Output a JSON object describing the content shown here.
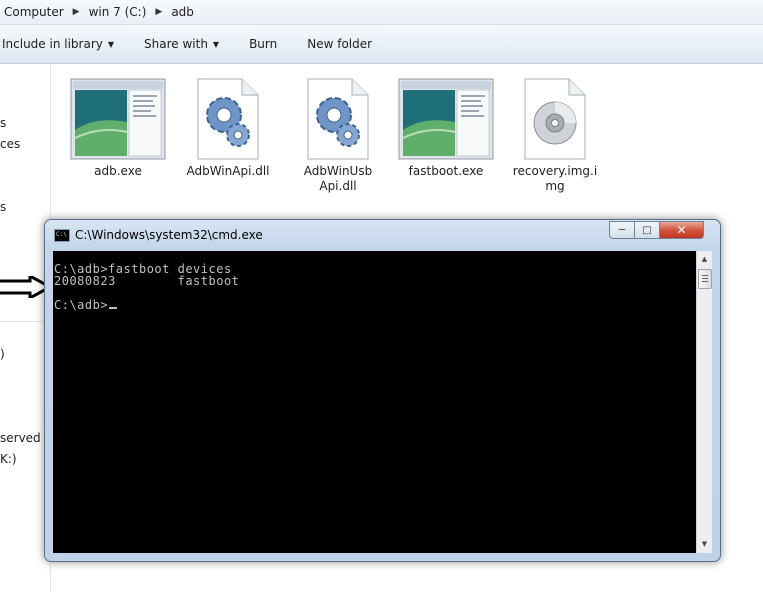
{
  "explorer": {
    "breadcrumb": [
      "Computer",
      "win 7 (C:)",
      "adb"
    ],
    "toolbar": {
      "include_in_library": "Include in library",
      "share_with": "Share with",
      "burn": "Burn",
      "new_folder": "New folder"
    },
    "nav_partial": [
      "s",
      "ces",
      "s",
      ")",
      "served (I",
      "K:)"
    ],
    "files": [
      {
        "name": "adb.exe",
        "icon": "application-window-icon"
      },
      {
        "name": "AdbWinApi.dll",
        "icon": "gears-dll-icon"
      },
      {
        "name": "AdbWinUsbApi.dll",
        "icon": "gears-dll-icon"
      },
      {
        "name": "fastboot.exe",
        "icon": "application-window-icon"
      },
      {
        "name": "recovery.img.img",
        "icon": "disc-image-icon"
      }
    ]
  },
  "cmd": {
    "title": "C:\\Windows\\system32\\cmd.exe",
    "icon_text": "C:\\",
    "lines": [
      "C:\\adb>fastboot devices",
      "20080823        fastboot",
      "",
      "C:\\adb>"
    ],
    "buttons": {
      "minimize": "─",
      "maximize": "□",
      "close": "✕"
    }
  },
  "colors": {
    "console_bg": "#000000",
    "console_text": "#c0c0c0",
    "window_frame": "#c3d5ea"
  }
}
